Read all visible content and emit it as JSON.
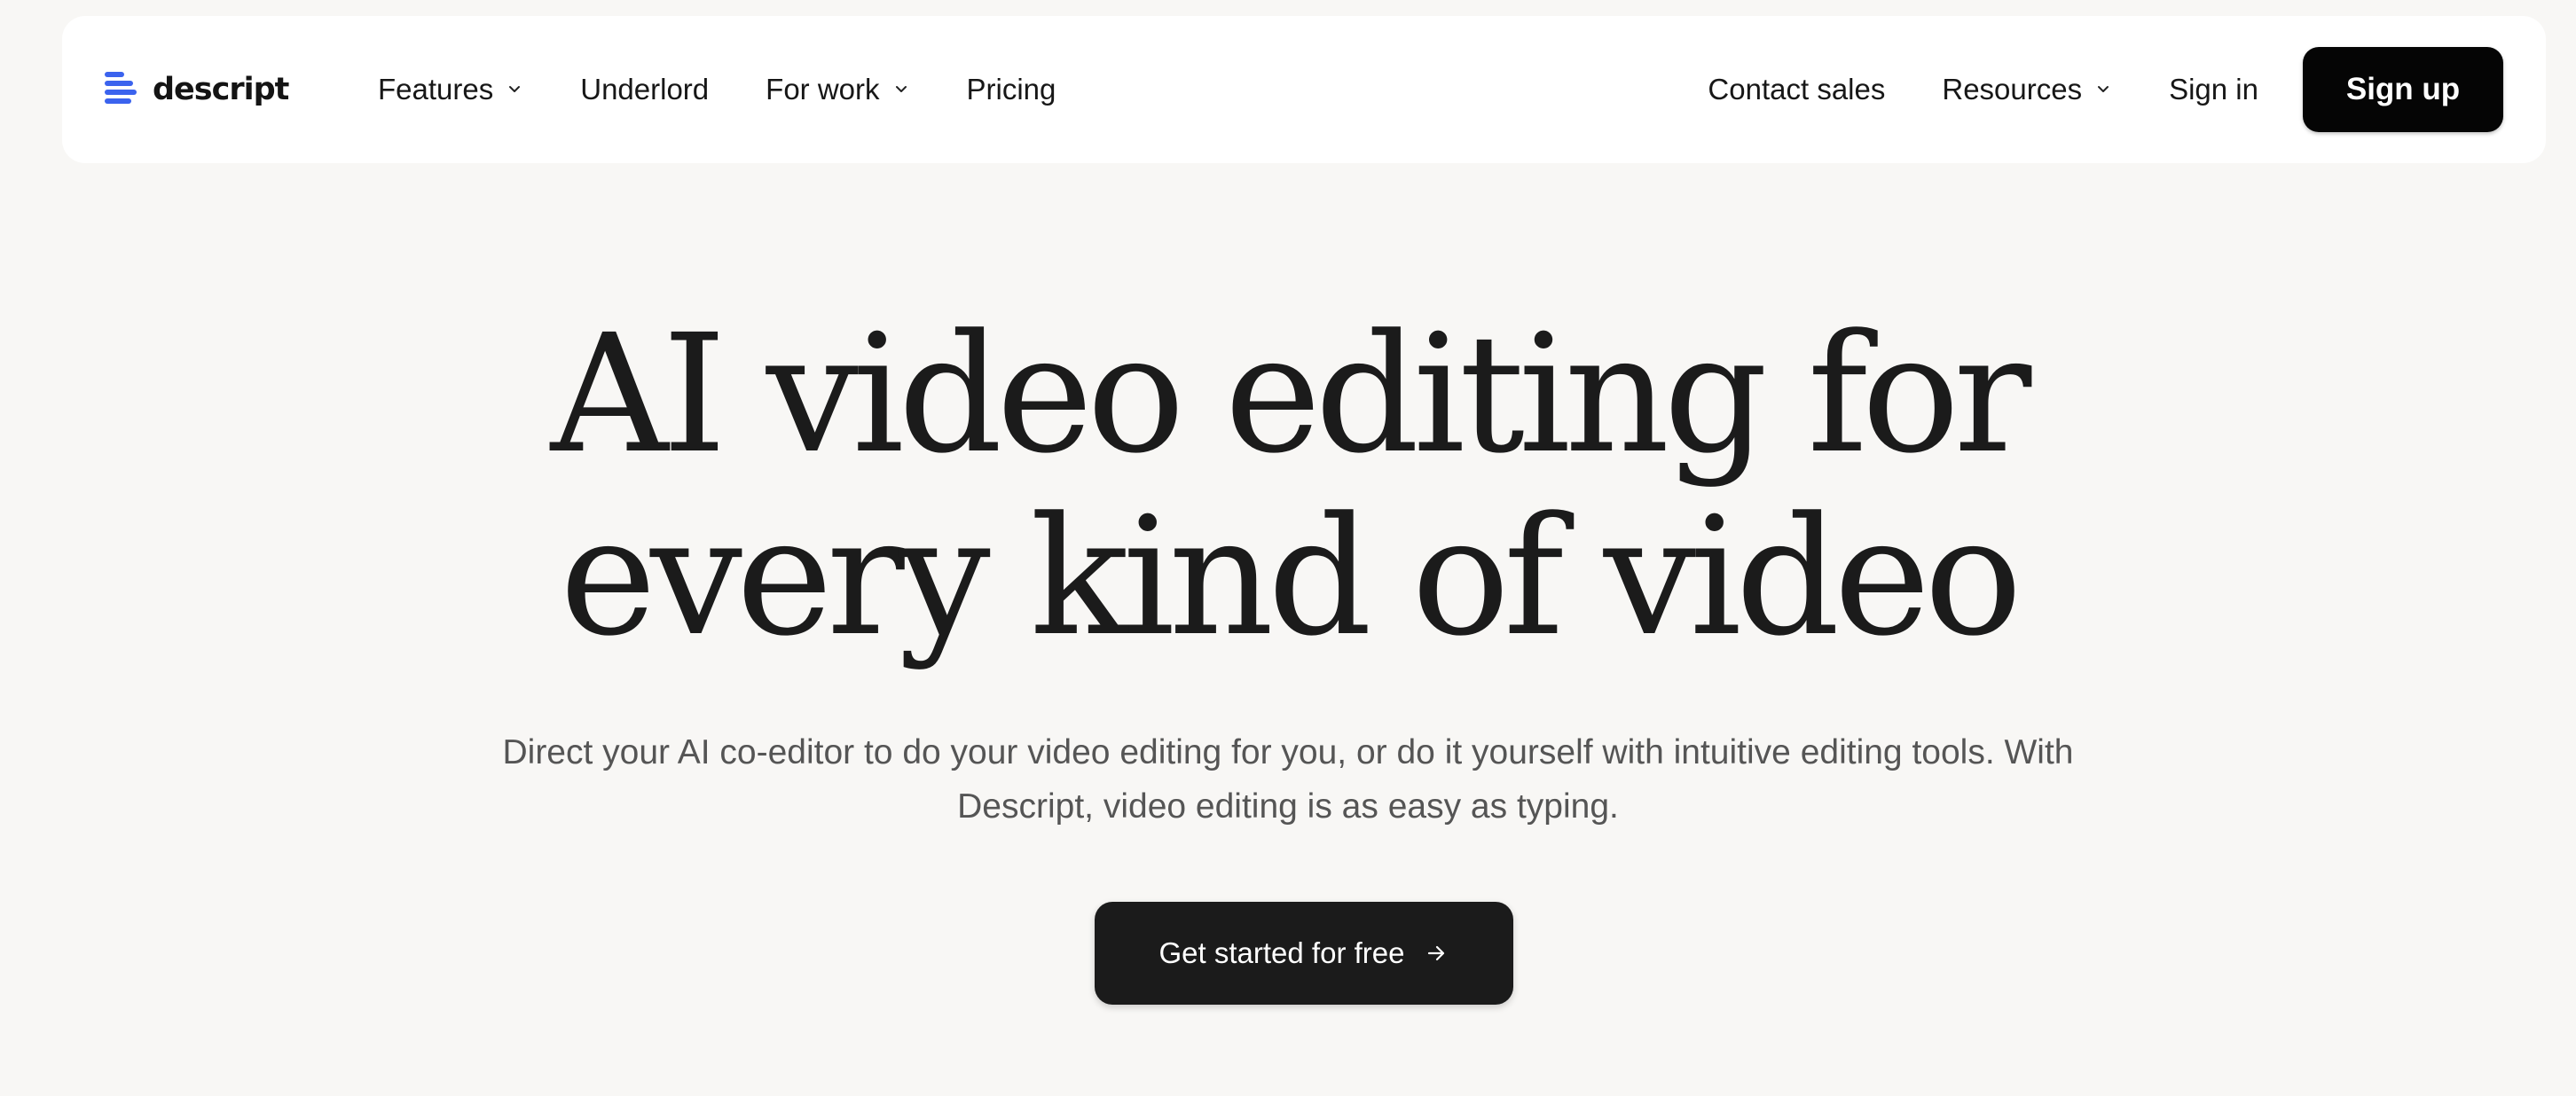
{
  "brand": {
    "name": "descript",
    "logo_icon": "descript-logo-icon",
    "logo_color": "#3b63ee"
  },
  "nav": {
    "left": [
      {
        "label": "Features",
        "dropdown": true
      },
      {
        "label": "Underlord",
        "dropdown": false
      },
      {
        "label": "For work",
        "dropdown": true
      },
      {
        "label": "Pricing",
        "dropdown": false
      }
    ],
    "right": {
      "contact_sales": "Contact sales",
      "resources": "Resources",
      "sign_in": "Sign in",
      "sign_up": "Sign up"
    }
  },
  "hero": {
    "title_line1": "AI video editing for",
    "title_line2": "every kind of video",
    "subtitle": "Direct your AI co-editor to do your video editing for you, or do it yourself with intuitive editing tools. With Descript, video editing is as easy as typing.",
    "cta_label": "Get started for free",
    "cta_icon": "arrow-right-icon"
  },
  "colors": {
    "page_background": "#f8f7f5",
    "navbar_background": "#ffffff",
    "primary_button": "#050505",
    "cta_button": "#1b1b1b",
    "heading_text": "#1b1b1b",
    "subtitle_text": "#555555"
  }
}
